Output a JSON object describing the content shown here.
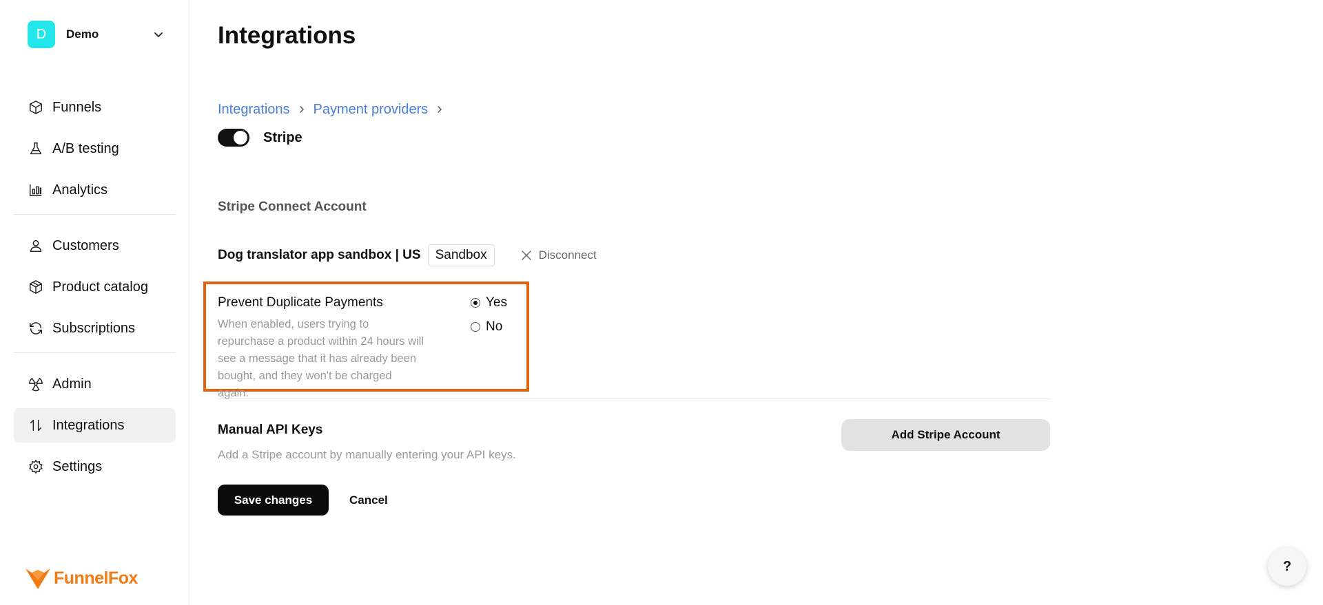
{
  "workspace": {
    "initial": "D",
    "name": "Demo",
    "avatar_color": "#22e6ea"
  },
  "sidebar": {
    "groups": [
      [
        {
          "label": "Funnels",
          "icon": "cube-icon"
        },
        {
          "label": "A/B testing",
          "icon": "flask-icon"
        },
        {
          "label": "Analytics",
          "icon": "bar-chart-icon"
        }
      ],
      [
        {
          "label": "Customers",
          "icon": "user-icon"
        },
        {
          "label": "Product catalog",
          "icon": "package-icon"
        },
        {
          "label": "Subscriptions",
          "icon": "refresh-icon"
        }
      ],
      [
        {
          "label": "Admin",
          "icon": "radiation-icon"
        },
        {
          "label": "Integrations",
          "icon": "arrows-up-down-icon",
          "active": true
        },
        {
          "label": "Settings",
          "icon": "gear-icon"
        }
      ]
    ]
  },
  "brand": {
    "name": "FunnelFox",
    "color": "#f07b14"
  },
  "page": {
    "title": "Integrations"
  },
  "breadcrumb": {
    "items": [
      "Integrations",
      "Payment providers"
    ]
  },
  "provider": {
    "name": "Stripe",
    "enabled": true
  },
  "connect": {
    "heading": "Stripe Connect Account",
    "account_name": "Dog translator app sandbox | US",
    "badge": "Sandbox",
    "disconnect_label": "Disconnect"
  },
  "duplicate_payments": {
    "title": "Prevent Duplicate Payments",
    "description": "When enabled, users trying to repurchase a product within 24 hours will see a message that it has already been bought, and they won't be charged again.",
    "options": [
      {
        "label": "Yes",
        "checked": true
      },
      {
        "label": "No",
        "checked": false
      }
    ],
    "highlight_color": "#e16412"
  },
  "manual": {
    "title": "Manual API Keys",
    "description": "Add a Stripe account by manually entering your API keys.",
    "add_button": "Add Stripe Account"
  },
  "actions": {
    "save": "Save changes",
    "cancel": "Cancel"
  },
  "help": {
    "label": "?"
  }
}
